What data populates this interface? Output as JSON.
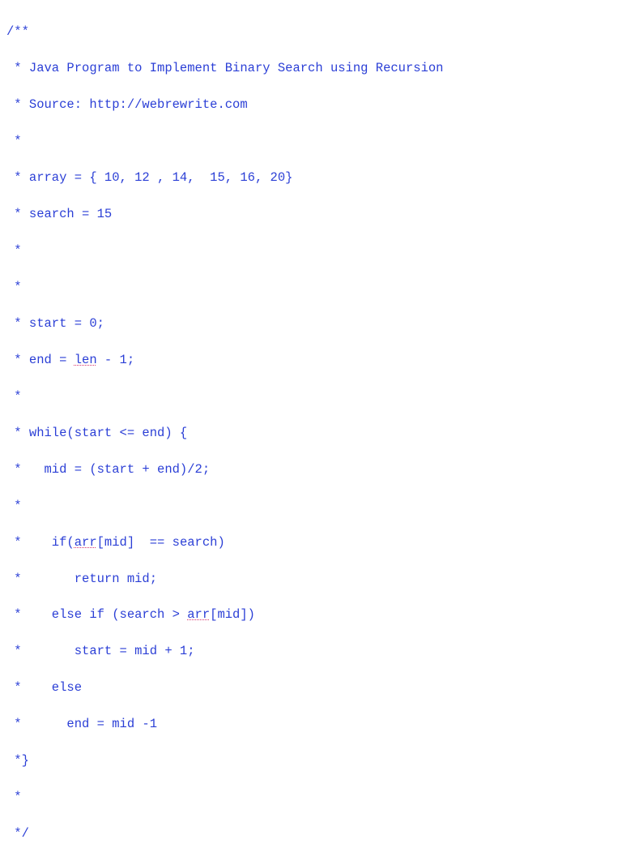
{
  "code": {
    "l0": "/**",
    "l1": " * Java Program to Implement Binary Search using Recursion",
    "l2": " * Source: http://webrewrite.com",
    "l3": " *",
    "l4": " * array = { 10, 12 , 14,  15, 16, 20}",
    "l5": " * search = 15",
    "l6": " *",
    "l7": " *",
    "l8": " * start = 0;",
    "l9_a": " * end = ",
    "l9_b": "len",
    "l9_c": " - 1;",
    "l10": " *",
    "l11": " * while(start <= end) {",
    "l12": " *   mid = (start + end)/2;",
    "l13": " *",
    "l14_a": " *    if(",
    "l14_b": "arr",
    "l14_c": "[mid]  == search)",
    "l15": " *       return mid;",
    "l16_a": " *    else if (search > ",
    "l16_b": "arr",
    "l16_c": "[mid])",
    "l17": " *       start = mid + 1;",
    "l18": " *    else",
    "l19": " *      end = mid -1",
    "l20": " *}",
    "l21": " *",
    "l22": " */"
  }
}
